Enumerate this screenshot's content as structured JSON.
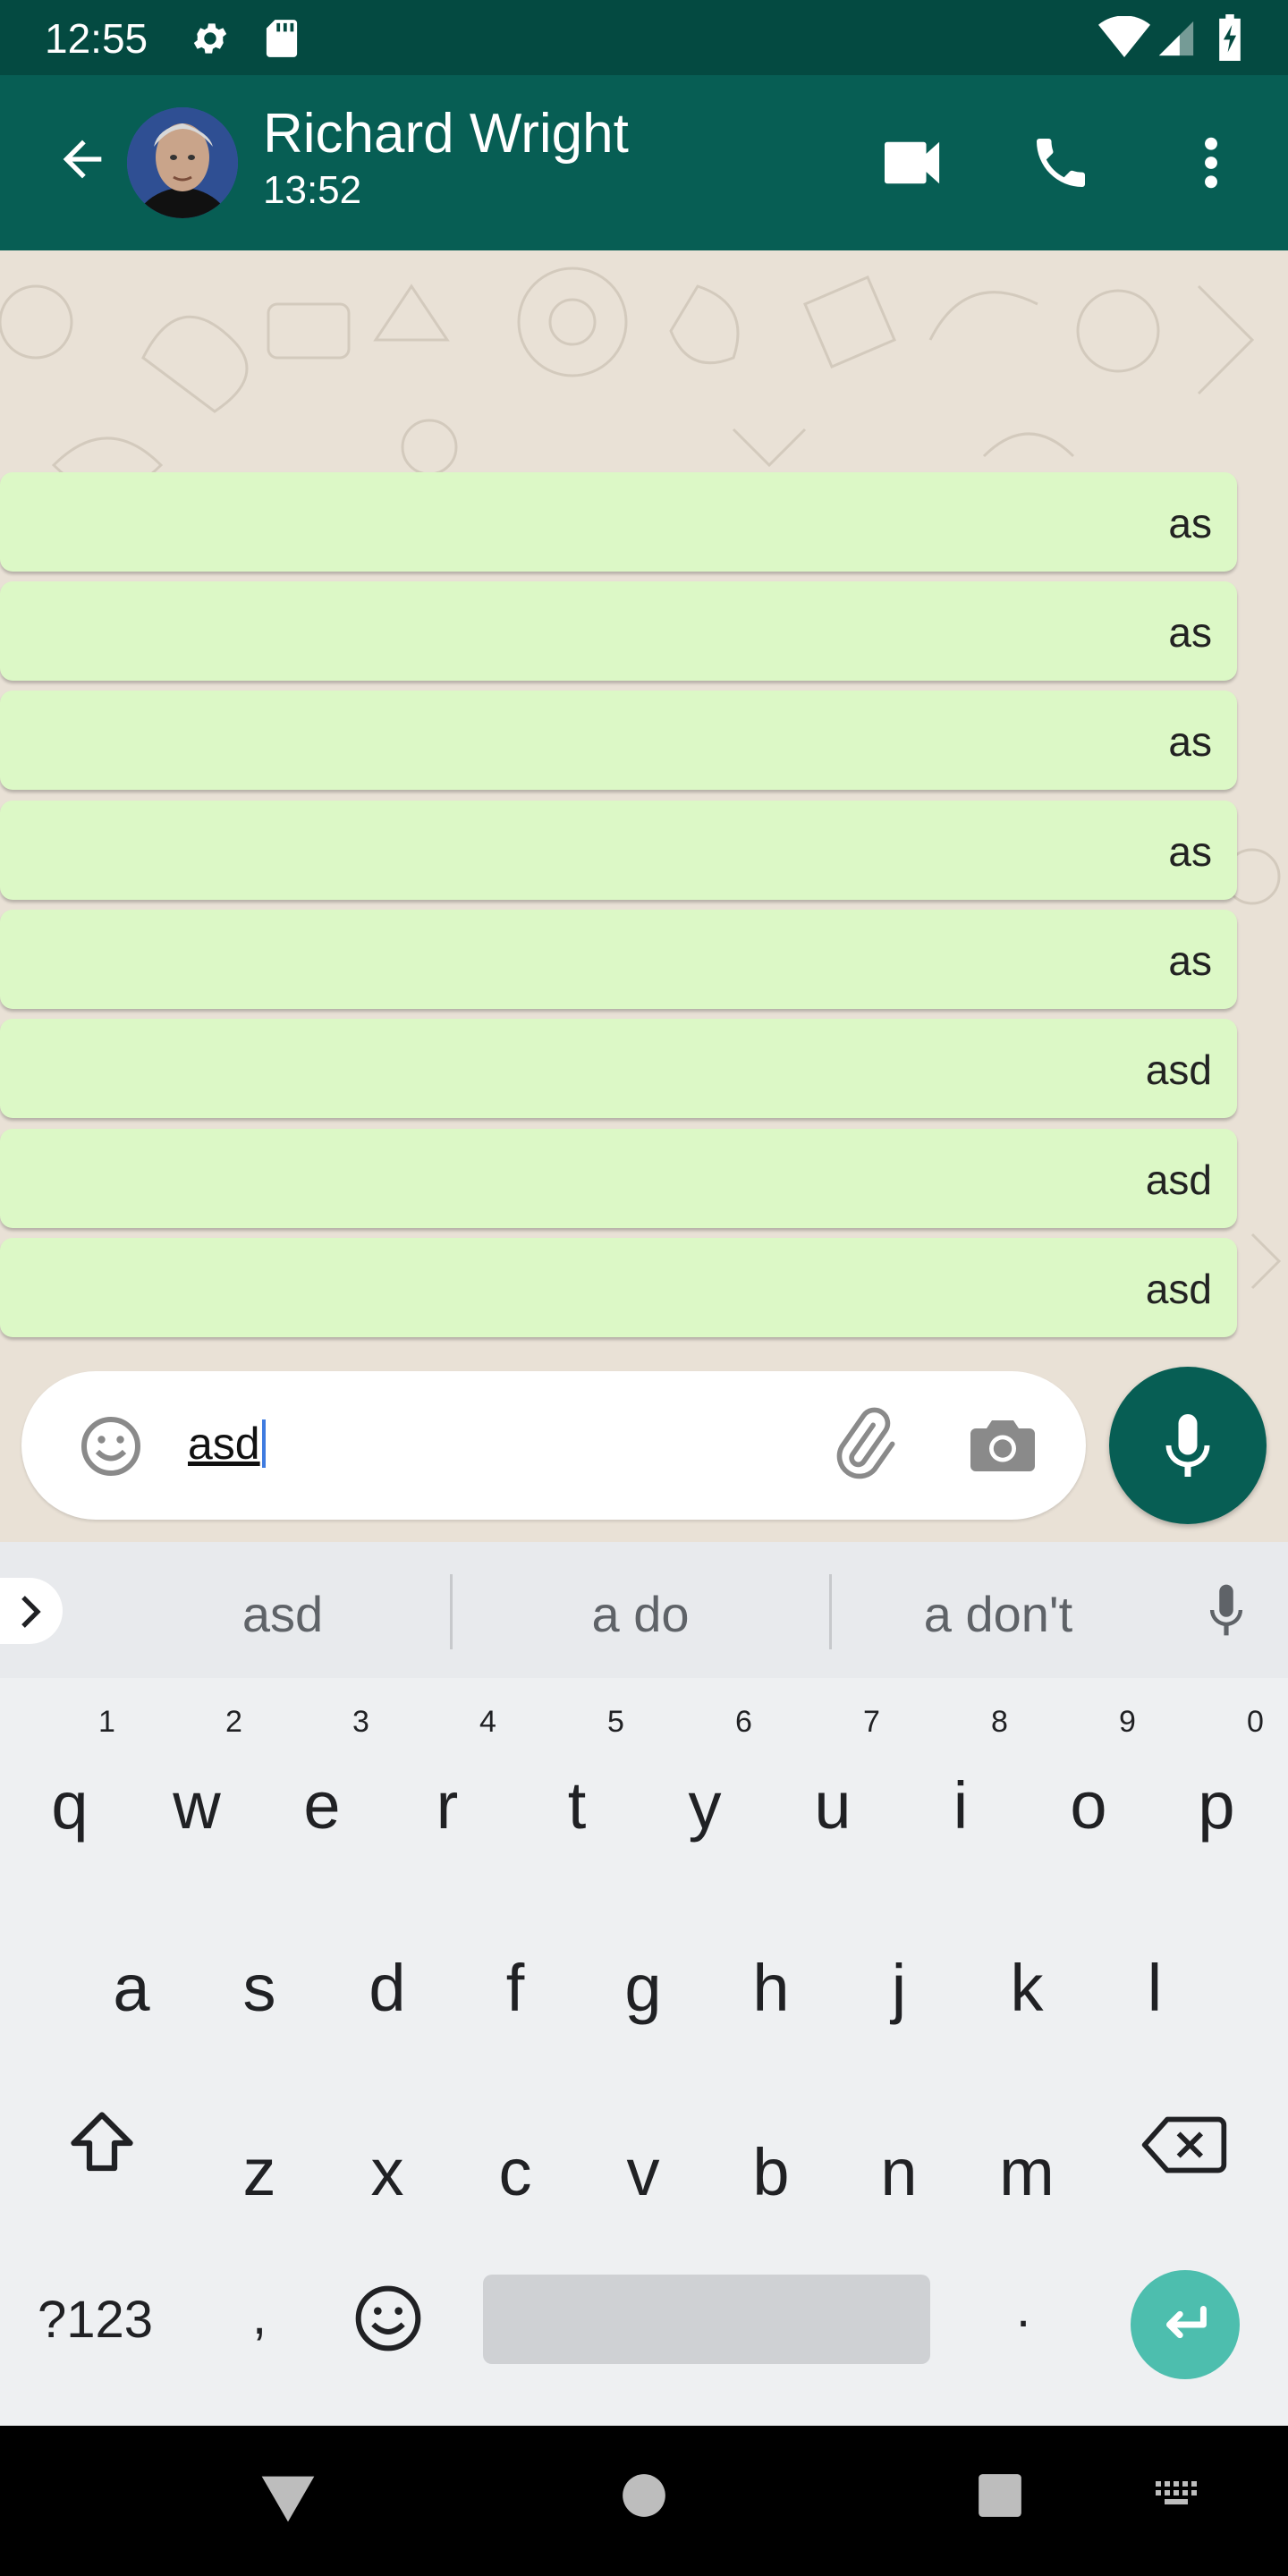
{
  "status_bar": {
    "time": "12:55"
  },
  "header": {
    "contact_name": "Richard Wright",
    "subtitle": "13:52"
  },
  "messages": [
    {
      "text": "as"
    },
    {
      "text": "as"
    },
    {
      "text": "as"
    },
    {
      "text": "as"
    },
    {
      "text": "as"
    },
    {
      "text": "asd"
    },
    {
      "text": "asd"
    },
    {
      "text": "asd"
    }
  ],
  "composer": {
    "value": "asd"
  },
  "suggestions": [
    "asd",
    "a do",
    "a don't"
  ],
  "keyboard": {
    "row1": [
      {
        "k": "q",
        "n": "1"
      },
      {
        "k": "w",
        "n": "2"
      },
      {
        "k": "e",
        "n": "3"
      },
      {
        "k": "r",
        "n": "4"
      },
      {
        "k": "t",
        "n": "5"
      },
      {
        "k": "y",
        "n": "6"
      },
      {
        "k": "u",
        "n": "7"
      },
      {
        "k": "i",
        "n": "8"
      },
      {
        "k": "o",
        "n": "9"
      },
      {
        "k": "p",
        "n": "0"
      }
    ],
    "row2": [
      "a",
      "s",
      "d",
      "f",
      "g",
      "h",
      "j",
      "k",
      "l"
    ],
    "row3": [
      "z",
      "x",
      "c",
      "v",
      "b",
      "n",
      "m"
    ],
    "symbols_label": "?123",
    "comma": ",",
    "period": "."
  },
  "colors": {
    "header": "#075e54",
    "status_bar": "#044a41",
    "bubble": "#dcf8c6",
    "chat_bg": "#e9e1d6",
    "accent": "#4dbeae"
  }
}
